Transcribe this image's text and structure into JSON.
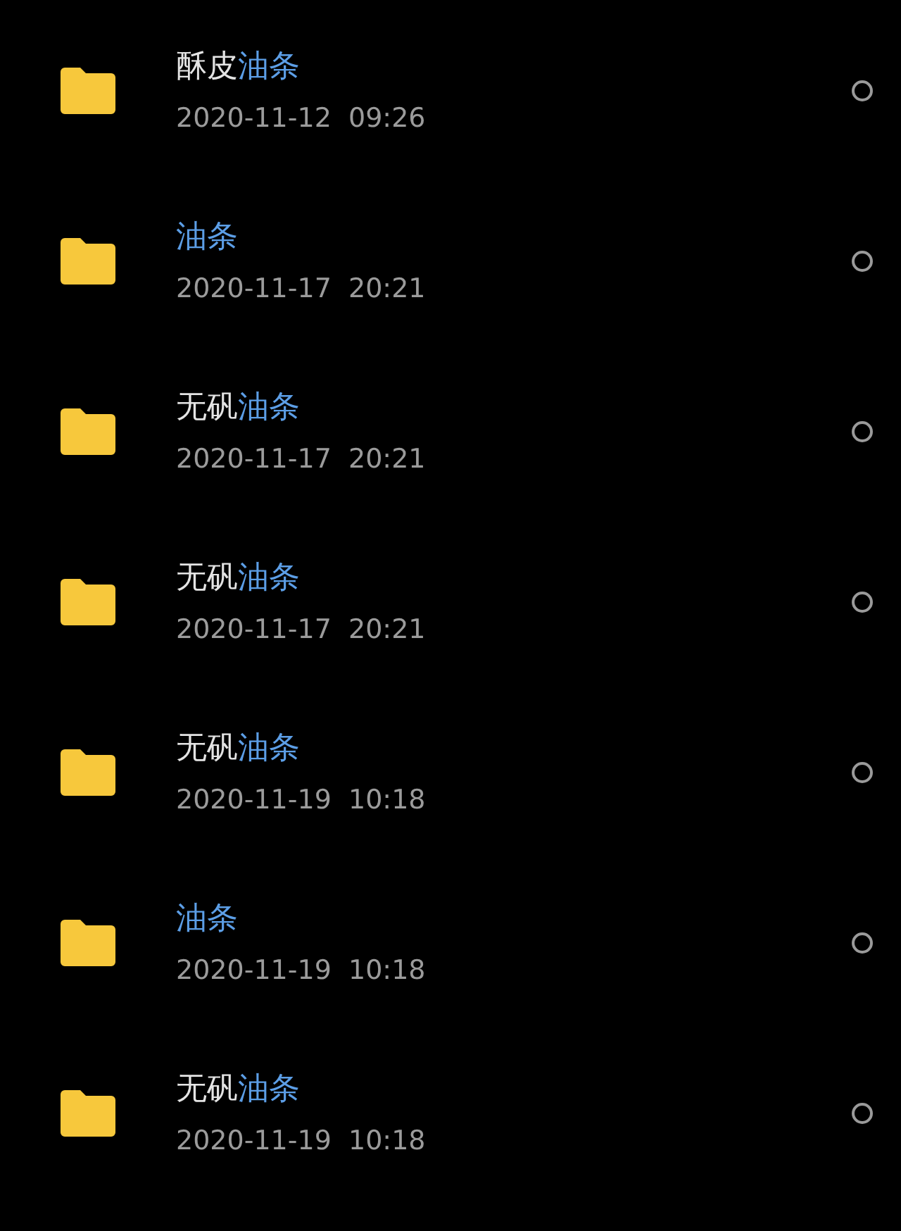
{
  "files": [
    {
      "name": [
        {
          "text": "酥皮",
          "highlight": false
        },
        {
          "text": "油条",
          "highlight": true
        }
      ],
      "date": "2020-11-12  09:26",
      "selected": false
    },
    {
      "name": [
        {
          "text": "油条",
          "highlight": true
        }
      ],
      "date": "2020-11-17  20:21",
      "selected": false
    },
    {
      "name": [
        {
          "text": "无矾",
          "highlight": false
        },
        {
          "text": "油条",
          "highlight": true
        }
      ],
      "date": "2020-11-17  20:21",
      "selected": false
    },
    {
      "name": [
        {
          "text": "无矾",
          "highlight": false
        },
        {
          "text": "油条",
          "highlight": true
        }
      ],
      "date": "2020-11-17  20:21",
      "selected": false
    },
    {
      "name": [
        {
          "text": "无矾",
          "highlight": false
        },
        {
          "text": "油条",
          "highlight": true
        }
      ],
      "date": "2020-11-19  10:18",
      "selected": false
    },
    {
      "name": [
        {
          "text": "油条",
          "highlight": true
        }
      ],
      "date": "2020-11-19  10:18",
      "selected": false
    },
    {
      "name": [
        {
          "text": "无矾",
          "highlight": false
        },
        {
          "text": "油条",
          "highlight": true
        }
      ],
      "date": "2020-11-19  10:18",
      "selected": false
    }
  ]
}
